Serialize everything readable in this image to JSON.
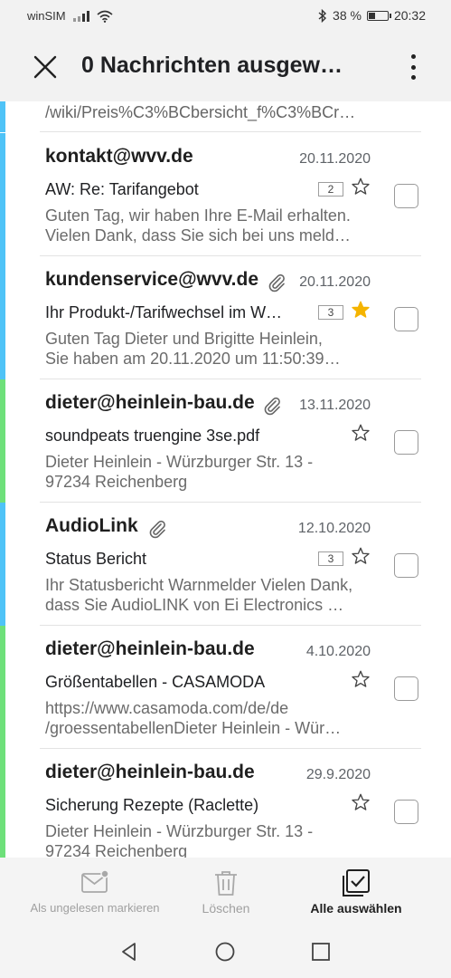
{
  "status_bar": {
    "carrier": "winSIM",
    "battery_percent": "38 %",
    "battery_level": 0.38,
    "time": "20:32"
  },
  "app_bar": {
    "title": "0 Nachrichten ausgew…",
    "close_icon": "close-icon",
    "more_icon": "more-vert-icon"
  },
  "list": {
    "partial_top_text": "/wiki/Preis%C3%BCbersicht_f%C3%BCr…",
    "items": [
      {
        "sender": "kontakt@wvv.de",
        "date": "20.11.2020",
        "subject": "AW: Re: Tarifangebot",
        "count": "2",
        "starred": false,
        "attachment": false,
        "preview_line1": "Guten Tag, wir haben Ihre E-Mail erhalten.",
        "preview_line2": "Vielen Dank, dass Sie sich bei uns meld…",
        "accent": "#4fc3f7"
      },
      {
        "sender": "kundenservice@wvv.de",
        "date": "20.11.2020",
        "subject": "Ihr Produkt-/Tarifwechsel im W…",
        "count": "3",
        "starred": true,
        "attachment": true,
        "preview_line1": "Guten Tag Dieter und Brigitte Heinlein,",
        "preview_line2": "Sie haben am 20.11.2020 um 11:50:39…",
        "accent": "#4fc3f7"
      },
      {
        "sender": "dieter@heinlein-bau.de",
        "date": "13.11.2020",
        "subject": "soundpeats truengine 3se.pdf",
        "count": "",
        "starred": false,
        "attachment": true,
        "preview_line1": "Dieter Heinlein - Würzburger Str. 13 -",
        "preview_line2": "97234 Reichenberg",
        "accent": "#6ee07a"
      },
      {
        "sender": "AudioLink",
        "date": "12.10.2020",
        "subject": "Status Bericht",
        "count": "3",
        "starred": false,
        "attachment": true,
        "preview_line1": "Ihr Statusbericht Warnmelder Vielen Dank,",
        "preview_line2": "dass Sie AudioLINK von Ei Electronics …",
        "accent": "#4fc3f7"
      },
      {
        "sender": "dieter@heinlein-bau.de",
        "date": "4.10.2020",
        "subject": "Größentabellen - CASAMODA",
        "count": "",
        "starred": false,
        "attachment": false,
        "preview_line1": "https://www.casamoda.com/de/de",
        "preview_line2": "/groessentabellenDieter Heinlein - Wür…",
        "accent": "#6ee07a"
      },
      {
        "sender": "dieter@heinlein-bau.de",
        "date": "29.9.2020",
        "subject": "Sicherung Rezepte (Raclette)",
        "count": "",
        "starred": false,
        "attachment": false,
        "preview_line1": "Dieter Heinlein - Würzburger Str. 13 -",
        "preview_line2": "97234 Reichenberg",
        "accent": "#6ee07a"
      }
    ]
  },
  "actions": {
    "mark_unread": "Als ungelesen markieren",
    "delete": "Löschen",
    "select_all": "Alle auswählen"
  },
  "colors": {
    "star_filled": "#f5b400",
    "blue_accent": "#4fc3f7",
    "green_accent": "#6ee07a"
  }
}
